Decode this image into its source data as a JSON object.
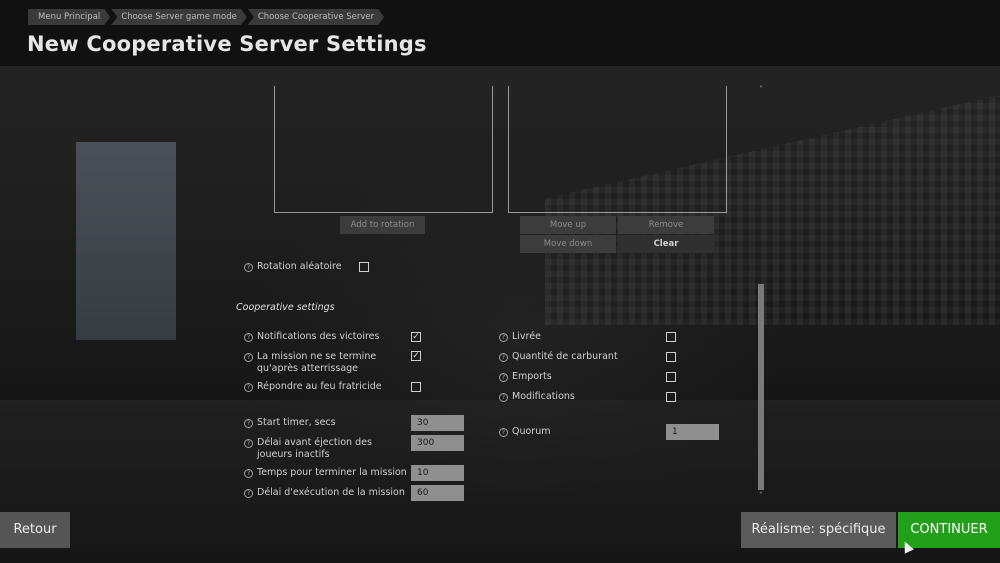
{
  "breadcrumb": [
    "Menu Principal",
    "Choose Server game mode",
    "Choose Cooperative Server"
  ],
  "page_title": "New Cooperative Server Settings",
  "rotation": {
    "add_to_rotation": "Add to rotation",
    "move_up": "Move up",
    "remove": "Remove",
    "move_down": "Move down",
    "clear": "Clear",
    "random_rotation_label": "Rotation aléatoire",
    "random_rotation_checked": false
  },
  "coop": {
    "section_title": "Cooperative settings",
    "left_checks": [
      {
        "label": "Notifications des victoires",
        "checked": true
      },
      {
        "label": "La mission ne se termine qu'après atterrissage",
        "checked": true
      },
      {
        "label": "Répondre au feu fratricide",
        "checked": false
      }
    ],
    "right_checks": [
      {
        "label": "Livrée",
        "checked": false
      },
      {
        "label": "Quantité de carburant",
        "checked": false
      },
      {
        "label": "Emports",
        "checked": false
      },
      {
        "label": "Modifications",
        "checked": false
      }
    ],
    "fields": [
      {
        "label": "Start timer, secs",
        "value": "30"
      },
      {
        "label": "Délai avant éjection des joueurs inactifs",
        "value": "300"
      },
      {
        "label": "Temps pour terminer la mission",
        "value": "10"
      },
      {
        "label": "Délai d'exécution de la mission",
        "value": "60"
      }
    ],
    "quorum": {
      "label": "Quorum",
      "value": "1"
    }
  },
  "check_mark": "✓",
  "help_glyph": "?",
  "scroll": {
    "up": "˄",
    "down": "˅"
  },
  "buttons": {
    "back": "Retour",
    "realism": "Réalisme: spécifique",
    "continue": "CONTINUER"
  },
  "colors": {
    "continue_button": "#22a01a",
    "header_bg": "#0f0f0f"
  }
}
